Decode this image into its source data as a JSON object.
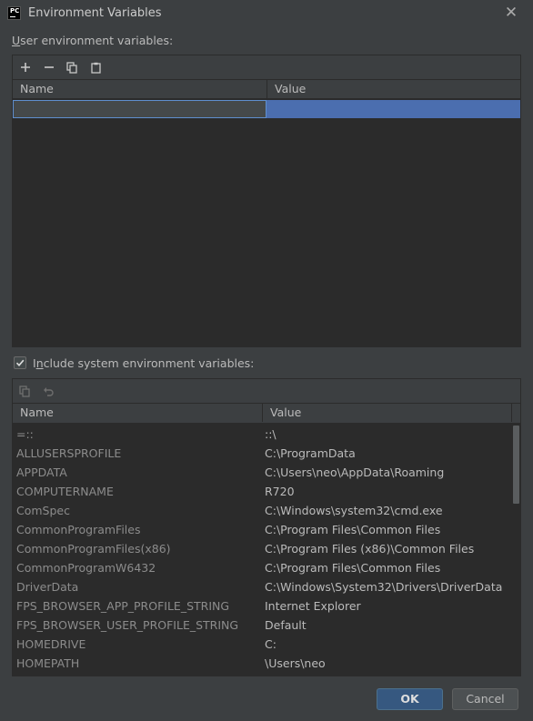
{
  "window": {
    "title": "Environment Variables",
    "logo_text": "PC"
  },
  "user_section": {
    "label": "User environment variables:",
    "columns": [
      "Name",
      "Value"
    ]
  },
  "include_system": {
    "label": "Include system environment variables:",
    "checked": true
  },
  "system_section": {
    "columns": [
      "Name",
      "Value"
    ],
    "rows": [
      {
        "name": "=::",
        "value": "::\\"
      },
      {
        "name": "ALLUSERSPROFILE",
        "value": "C:\\ProgramData"
      },
      {
        "name": "APPDATA",
        "value": "C:\\Users\\neo\\AppData\\Roaming"
      },
      {
        "name": "COMPUTERNAME",
        "value": "R720"
      },
      {
        "name": "ComSpec",
        "value": "C:\\Windows\\system32\\cmd.exe"
      },
      {
        "name": "CommonProgramFiles",
        "value": "C:\\Program Files\\Common Files"
      },
      {
        "name": "CommonProgramFiles(x86)",
        "value": "C:\\Program Files (x86)\\Common Files"
      },
      {
        "name": "CommonProgramW6432",
        "value": "C:\\Program Files\\Common Files"
      },
      {
        "name": "DriverData",
        "value": "C:\\Windows\\System32\\Drivers\\DriverData"
      },
      {
        "name": "FPS_BROWSER_APP_PROFILE_STRING",
        "value": "Internet Explorer"
      },
      {
        "name": "FPS_BROWSER_USER_PROFILE_STRING",
        "value": "Default"
      },
      {
        "name": "HOMEDRIVE",
        "value": "C:"
      },
      {
        "name": "HOMEPATH",
        "value": "\\Users\\neo"
      }
    ]
  },
  "buttons": {
    "ok": "OK",
    "cancel": "Cancel"
  },
  "colors": {
    "background": "#3c3f41",
    "table_bg": "#2b2b2b",
    "selection": "#4b6eaf",
    "ok_button": "#365880"
  }
}
